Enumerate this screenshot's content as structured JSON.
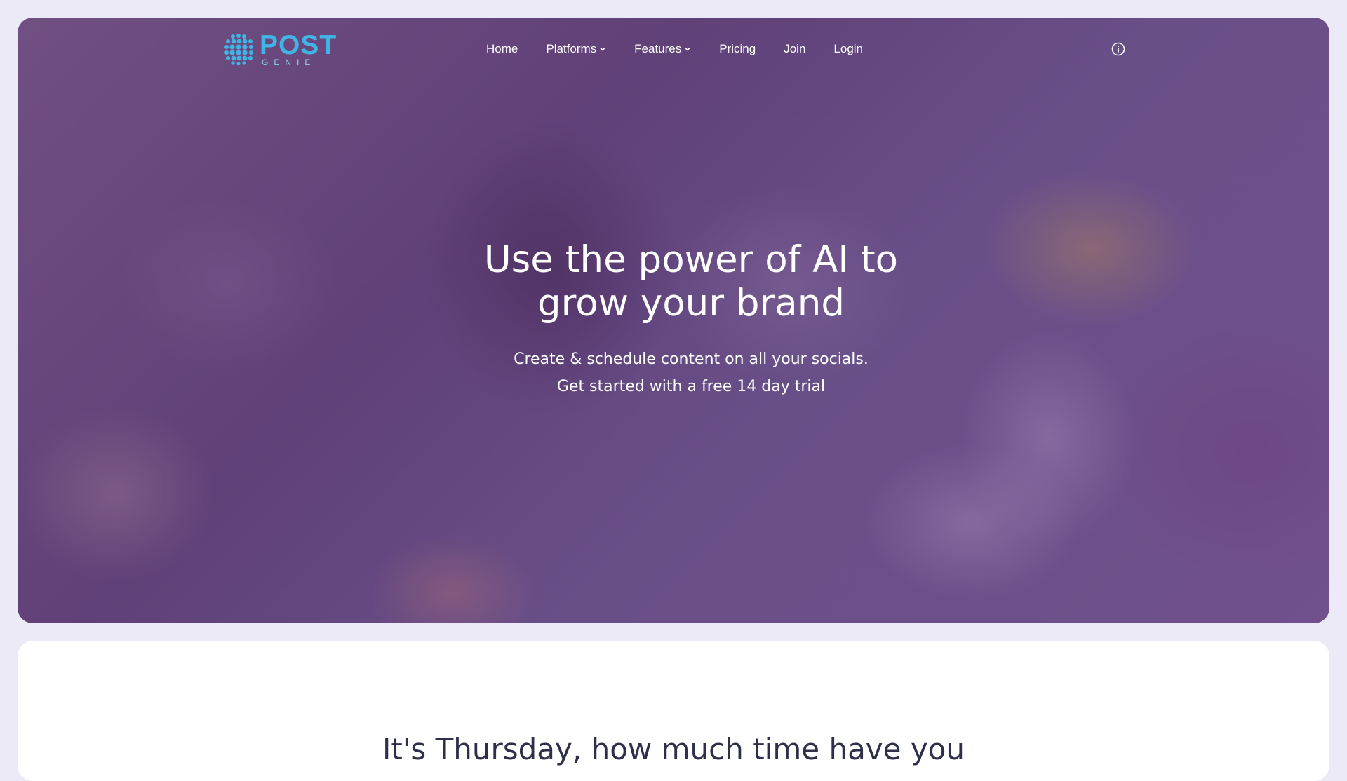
{
  "brand": {
    "name": "POST",
    "tagline": "GENIE",
    "color": "#40b4e4"
  },
  "nav": {
    "items": [
      {
        "label": "Home",
        "has_dropdown": false
      },
      {
        "label": "Platforms",
        "has_dropdown": true
      },
      {
        "label": "Features",
        "has_dropdown": true
      },
      {
        "label": "Pricing",
        "has_dropdown": false
      },
      {
        "label": "Join",
        "has_dropdown": false
      },
      {
        "label": "Login",
        "has_dropdown": false
      }
    ],
    "info_icon": "info-circle-icon"
  },
  "hero": {
    "title_line1": "Use the power of AI to",
    "title_line2": "grow your brand",
    "subtitle_line1": "Create & schedule content on all your socials.",
    "subtitle_line2": "Get started with a free 14 day trial",
    "overlay_color": "#66428c"
  },
  "section": {
    "heading": "It's Thursday, how much time have you"
  }
}
